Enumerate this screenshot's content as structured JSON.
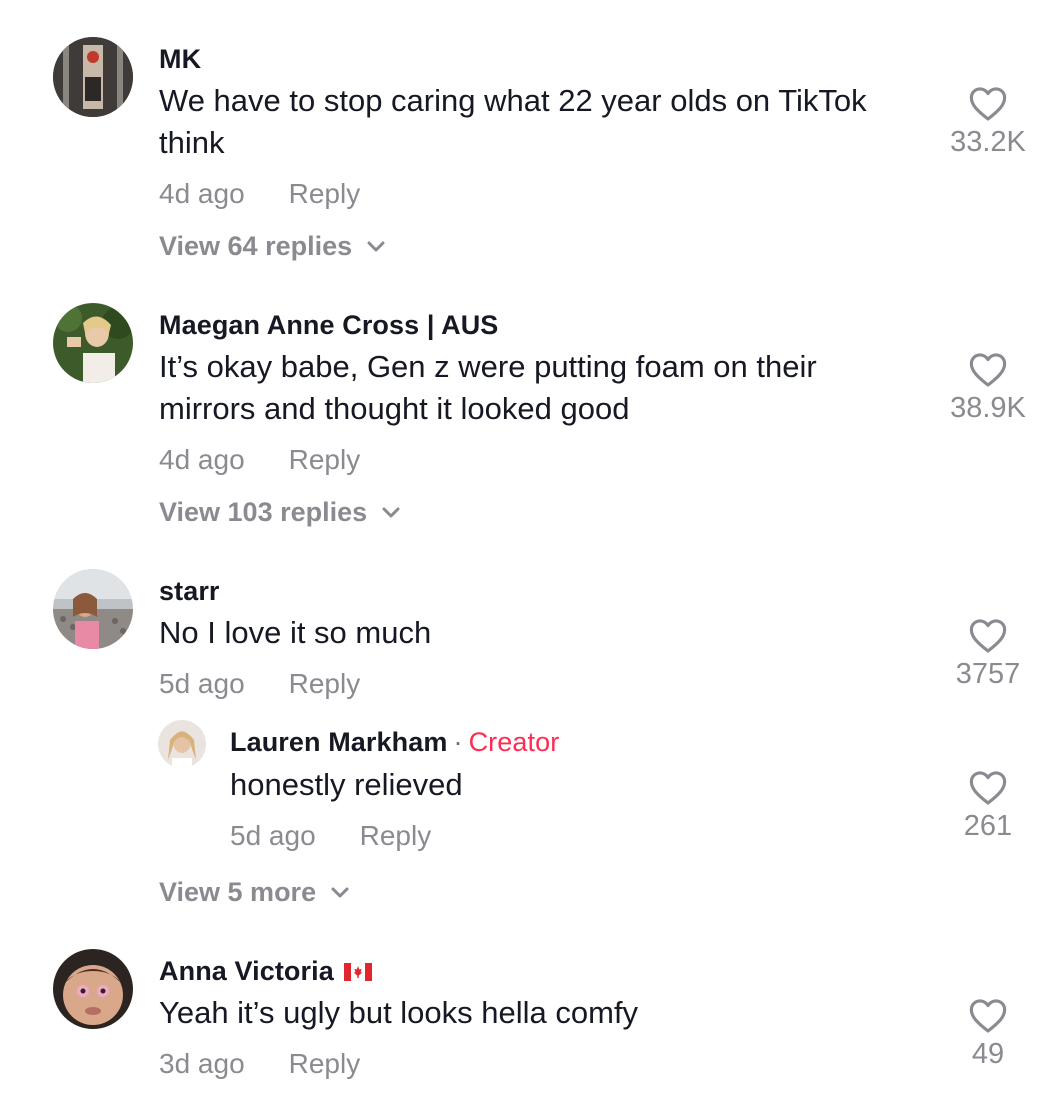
{
  "comments": [
    {
      "username": "MK",
      "text_lines": [
        "We have to stop caring what 22 year olds on TikTok",
        "think"
      ],
      "time": "4d ago",
      "reply_label": "Reply",
      "view_replies": "View 64 replies",
      "likes": "33.2K"
    },
    {
      "username": "Maegan Anne Cross | AUS",
      "text_lines": [
        "It’s okay babe, Gen z were putting foam on their",
        "mirrors and thought it looked good"
      ],
      "time": "4d ago",
      "reply_label": "Reply",
      "view_replies": "View 103 replies",
      "likes": "38.9K"
    },
    {
      "username": "starr",
      "text_lines": [
        "No I love it so much"
      ],
      "time": "5d ago",
      "reply_label": "Reply",
      "likes": "3757",
      "reply": {
        "username": "Lauren Markham",
        "separator": "·",
        "badge": "Creator",
        "text": "honestly relieved",
        "time": "5d ago",
        "reply_label": "Reply",
        "likes": "261"
      },
      "view_more": "View 5 more"
    },
    {
      "username": "Anna Victoria",
      "flag": "canada-flag",
      "text_lines": [
        "Yeah it’s ugly but looks hella comfy"
      ],
      "time": "3d ago",
      "reply_label": "Reply",
      "likes": "49"
    }
  ],
  "colors": {
    "text": "#161823",
    "muted": "#8a8b91",
    "creator": "#fe2c55"
  }
}
